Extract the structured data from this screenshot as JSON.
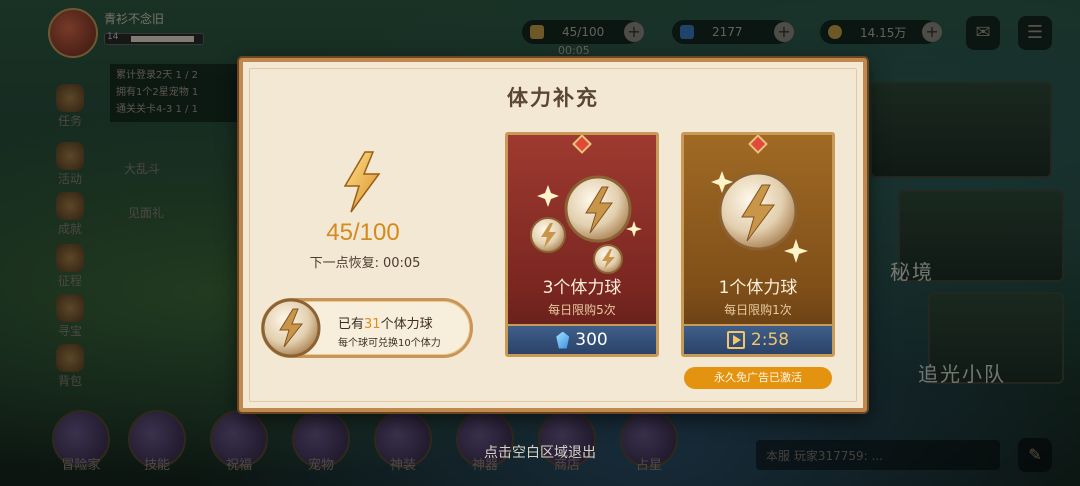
{
  "background": {
    "player_name": "青衫不念旧",
    "player_level": "14",
    "level_progress": 0.9,
    "resources": {
      "stamina": "45/100",
      "stamina_timer": "00:05",
      "gems": "2177",
      "gold": "14.15万"
    },
    "quest_tracker": {
      "title": "累计登录2天 1 / 2",
      "line2": "拥有1个2星宠物 1",
      "line3": "通关关卡4-3 1 / 1"
    },
    "side_menu": [
      "任务",
      "活动",
      "成就",
      "征程",
      "寻宝",
      "背包"
    ],
    "floating_labels": {
      "brawl": "大乱斗",
      "meet": "见面礼"
    },
    "bottom_nav": [
      "冒险家",
      "技能",
      "祝福",
      "宠物",
      "神装",
      "神器",
      "商店",
      "占星"
    ],
    "right_panels": {
      "secret_realm": "秘境",
      "light_squad": "追光小队"
    },
    "chat_placeholder": "本服   玩家317759: ..."
  },
  "modal": {
    "title": "体力补充",
    "stamina_value": "45/100",
    "recover_label": "下一点恢复:",
    "recover_time": "00:05",
    "owned_prefix": "已有",
    "owned_count": "31",
    "owned_suffix": "个体力球",
    "exchange_note": "每个球可兑换10个体力",
    "offers": [
      {
        "name": "3个体力球",
        "limit": "每日限购5次",
        "price": "300",
        "price_icon": "crystal-icon"
      },
      {
        "name": "1个体力球",
        "limit": "每日限购1次",
        "price": "2:58",
        "price_icon": "video-ad-icon"
      }
    ],
    "adfree_label": "永久免广告已激活"
  },
  "exit_hint": "点击空白区域退出",
  "colors": {
    "panel_bg": "#f3e8d4",
    "panel_border": "#c08a4e",
    "accent_orange": "#e08e1b",
    "red_card": "#9e3a30",
    "gold_card": "#a06a24",
    "price_bar": "#2b4368"
  }
}
